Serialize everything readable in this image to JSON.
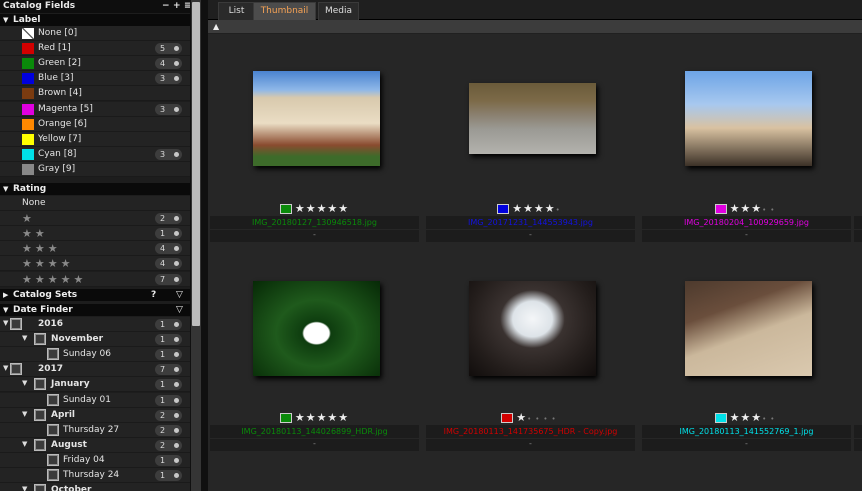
{
  "sidebar": {
    "title": "Catalog Fields",
    "controls": [
      "−",
      "+",
      "≡"
    ],
    "label_section": {
      "title": "Label",
      "items": [
        {
          "name": "None [0]",
          "color": "none",
          "count": ""
        },
        {
          "name": "Red [1]",
          "color": "#d20000",
          "count": "5"
        },
        {
          "name": "Green [2]",
          "color": "#0a8a0a",
          "count": "4"
        },
        {
          "name": "Blue [3]",
          "color": "#0000dd",
          "count": "3"
        },
        {
          "name": "Brown [4]",
          "color": "#7a3b10",
          "count": ""
        },
        {
          "name": "Magenta [5]",
          "color": "#e000e0",
          "count": "3"
        },
        {
          "name": "Orange [6]",
          "color": "#ff8800",
          "count": ""
        },
        {
          "name": "Yellow [7]",
          "color": "#ffff00",
          "count": ""
        },
        {
          "name": "Cyan [8]",
          "color": "#00e0e8",
          "count": "3"
        },
        {
          "name": "Gray [9]",
          "color": "#888888",
          "count": ""
        }
      ]
    },
    "rating_section": {
      "title": "Rating",
      "items": [
        {
          "stars": "None",
          "count": ""
        },
        {
          "stars": "★",
          "count": "2"
        },
        {
          "stars": "★★",
          "count": "1"
        },
        {
          "stars": "★★★",
          "count": "4"
        },
        {
          "stars": "★★★★",
          "count": "4"
        },
        {
          "stars": "★★★★★",
          "count": "7"
        }
      ]
    },
    "catalog_sets": {
      "title": "Catalog Sets",
      "icons": [
        "?",
        "▽"
      ]
    },
    "date_finder": {
      "title": "Date Finder",
      "icon": "▽",
      "items": [
        {
          "level": 0,
          "label": "2016",
          "count": "1",
          "bold": true,
          "arrow": "▼"
        },
        {
          "level": 1,
          "label": "November",
          "count": "1",
          "bold": true,
          "arrow": "▼"
        },
        {
          "level": 2,
          "label": "Sunday 06",
          "count": "1",
          "bold": false,
          "arrow": ""
        },
        {
          "level": 0,
          "label": "2017",
          "count": "7",
          "bold": true,
          "arrow": "▼"
        },
        {
          "level": 1,
          "label": "January",
          "count": "1",
          "bold": true,
          "arrow": "▼"
        },
        {
          "level": 2,
          "label": "Sunday 01",
          "count": "1",
          "bold": false,
          "arrow": ""
        },
        {
          "level": 1,
          "label": "April",
          "count": "2",
          "bold": true,
          "arrow": "▼"
        },
        {
          "level": 2,
          "label": "Thursday 27",
          "count": "2",
          "bold": false,
          "arrow": ""
        },
        {
          "level": 1,
          "label": "August",
          "count": "2",
          "bold": true,
          "arrow": "▼"
        },
        {
          "level": 2,
          "label": "Friday 04",
          "count": "1",
          "bold": false,
          "arrow": ""
        },
        {
          "level": 2,
          "label": "Thursday 24",
          "count": "1",
          "bold": false,
          "arrow": ""
        },
        {
          "level": 1,
          "label": "October",
          "count": "",
          "bold": true,
          "arrow": "▼"
        }
      ]
    }
  },
  "main": {
    "tabs": [
      {
        "label": "List",
        "active": false
      },
      {
        "label": "Thumbnail",
        "active": true
      },
      {
        "label": "Media",
        "active": false
      }
    ],
    "toolbar_icon": "▲",
    "thumbnails": [
      {
        "filename": "IMG_20180127_130946518.jpg",
        "label_color": "#0a8a0a",
        "rating": 5,
        "sub": "-",
        "scene": "house"
      },
      {
        "filename": "IMG_20171231_144553943.jpg",
        "label_color": "#0000dd",
        "rating": 4,
        "sub": "-",
        "scene": "car"
      },
      {
        "filename": "IMG_20180204_100929659.jpg",
        "label_color": "#e000e0",
        "rating": 3,
        "sub": "-",
        "scene": "selfie"
      },
      {
        "filename": "IMG_20180113_144026899_HDR.jpg",
        "label_color": "#0a8a0a",
        "rating": 5,
        "sub": "-",
        "scene": "lily"
      },
      {
        "filename": "IMG_20180113_141735675_HDR - Copy.jpg",
        "label_color": "#d20000",
        "rating": 1,
        "sub": "-",
        "scene": "cave"
      },
      {
        "filename": "IMG_20180113_141552769_1.jpg",
        "label_color": "#00e0e8",
        "rating": 3,
        "sub": "-",
        "scene": "beach"
      }
    ]
  }
}
